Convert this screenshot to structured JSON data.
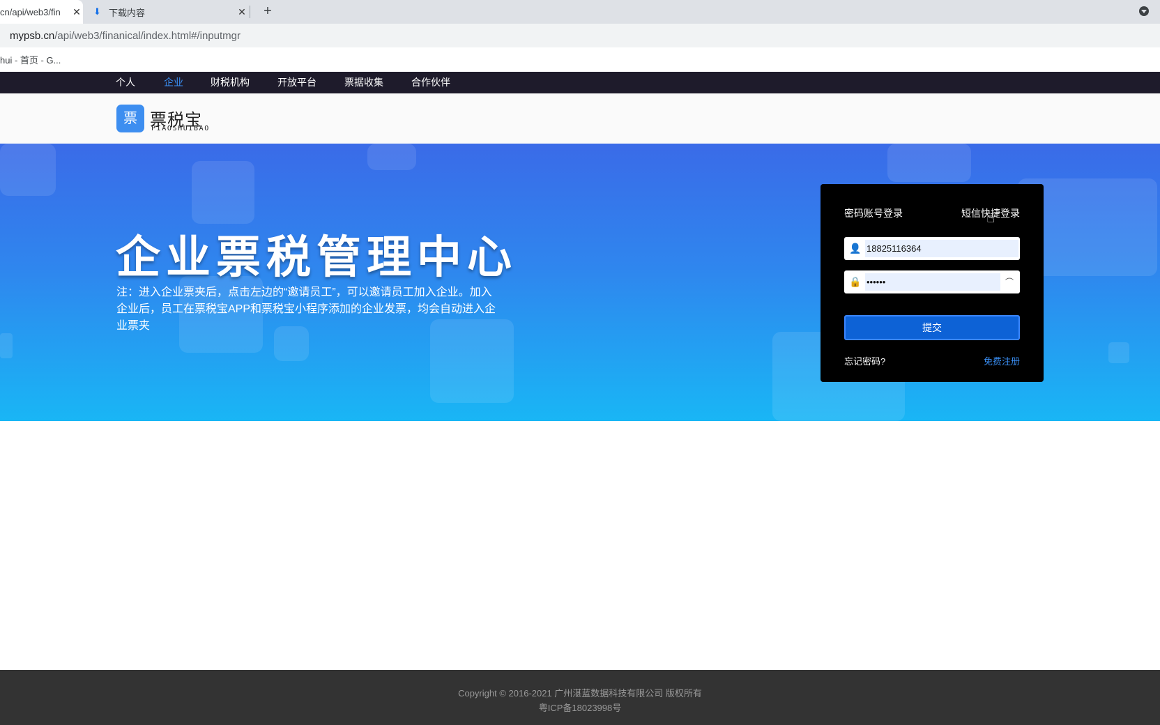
{
  "browser": {
    "tabs": [
      {
        "title": "cn/api/web3/fin",
        "close": "✕"
      },
      {
        "title": "下载内容",
        "close": "✕"
      }
    ],
    "new_tab": "+",
    "url_host": "mypsb.cn",
    "url_path": "/api/web3/finanical/index.html#/inputmgr",
    "bookmark": "hui - 首页 - G..."
  },
  "site_nav": {
    "items": [
      "个人",
      "企业",
      "财税机构",
      "开放平台",
      "票据收集",
      "合作伙伴"
    ],
    "active": "企业"
  },
  "logo": {
    "icon_char": "票",
    "name_cn": "票税宝",
    "name_en": "PIAOSHUIBAO"
  },
  "hero": {
    "title": "企业票税管理中心",
    "note": "注：进入企业票夹后，点击左边的“邀请员工”，可以邀请员工加入企业。加入企业后，员工在票税宝APP和票税宝小程序添加的企业发票，均会自动进入企业票夹"
  },
  "login": {
    "tab_password": "密码账号登录",
    "tab_sms": "短信快捷登录",
    "username_value": "18825116364",
    "password_value": "••••••",
    "submit_label": "提交",
    "forgot_label": "忘记密码?",
    "register_label": "免费注册"
  },
  "footer": {
    "copyright": "Copyright © 2016-2021 广州湛蓝数据科技有限公司 版权所有",
    "icp": "粤ICP备18023998号"
  },
  "colors": {
    "nav_bg": "#1e1b2b",
    "nav_active": "#3a8ff5",
    "hero_top": "#3a6be8",
    "hero_bottom": "#19b6f5",
    "login_bg": "#000000",
    "submit_bg": "#0d62d6",
    "footer_bg": "#333333"
  }
}
